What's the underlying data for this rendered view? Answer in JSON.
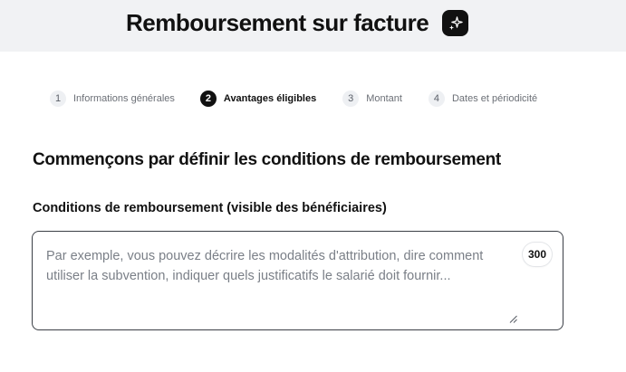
{
  "header": {
    "title": "Remboursement sur facture",
    "action_icon": "sparkles-icon"
  },
  "stepper": {
    "steps": [
      {
        "number": "1",
        "label": "Informations générales",
        "active": false
      },
      {
        "number": "2",
        "label": "Avantages éligibles",
        "active": true
      },
      {
        "number": "3",
        "label": "Montant",
        "active": false
      },
      {
        "number": "4",
        "label": "Dates et périodicité",
        "active": false
      }
    ]
  },
  "form": {
    "section_title": "Commençons par définir les conditions de remboursement",
    "conditions_label": "Conditions de remboursement (visible des bénéficiaires)",
    "conditions_placeholder": "Par exemple, vous pouvez décrire les modalités d'attribution, dire comment utiliser la subvention, indiquer quels justificatifs le salarié doit fournir...",
    "conditions_value": "",
    "char_counter": "300"
  },
  "colors": {
    "header_bg": "#f1f2f4",
    "active_step": "#111111",
    "text_primary": "#111111",
    "placeholder": "#7a7f87"
  }
}
